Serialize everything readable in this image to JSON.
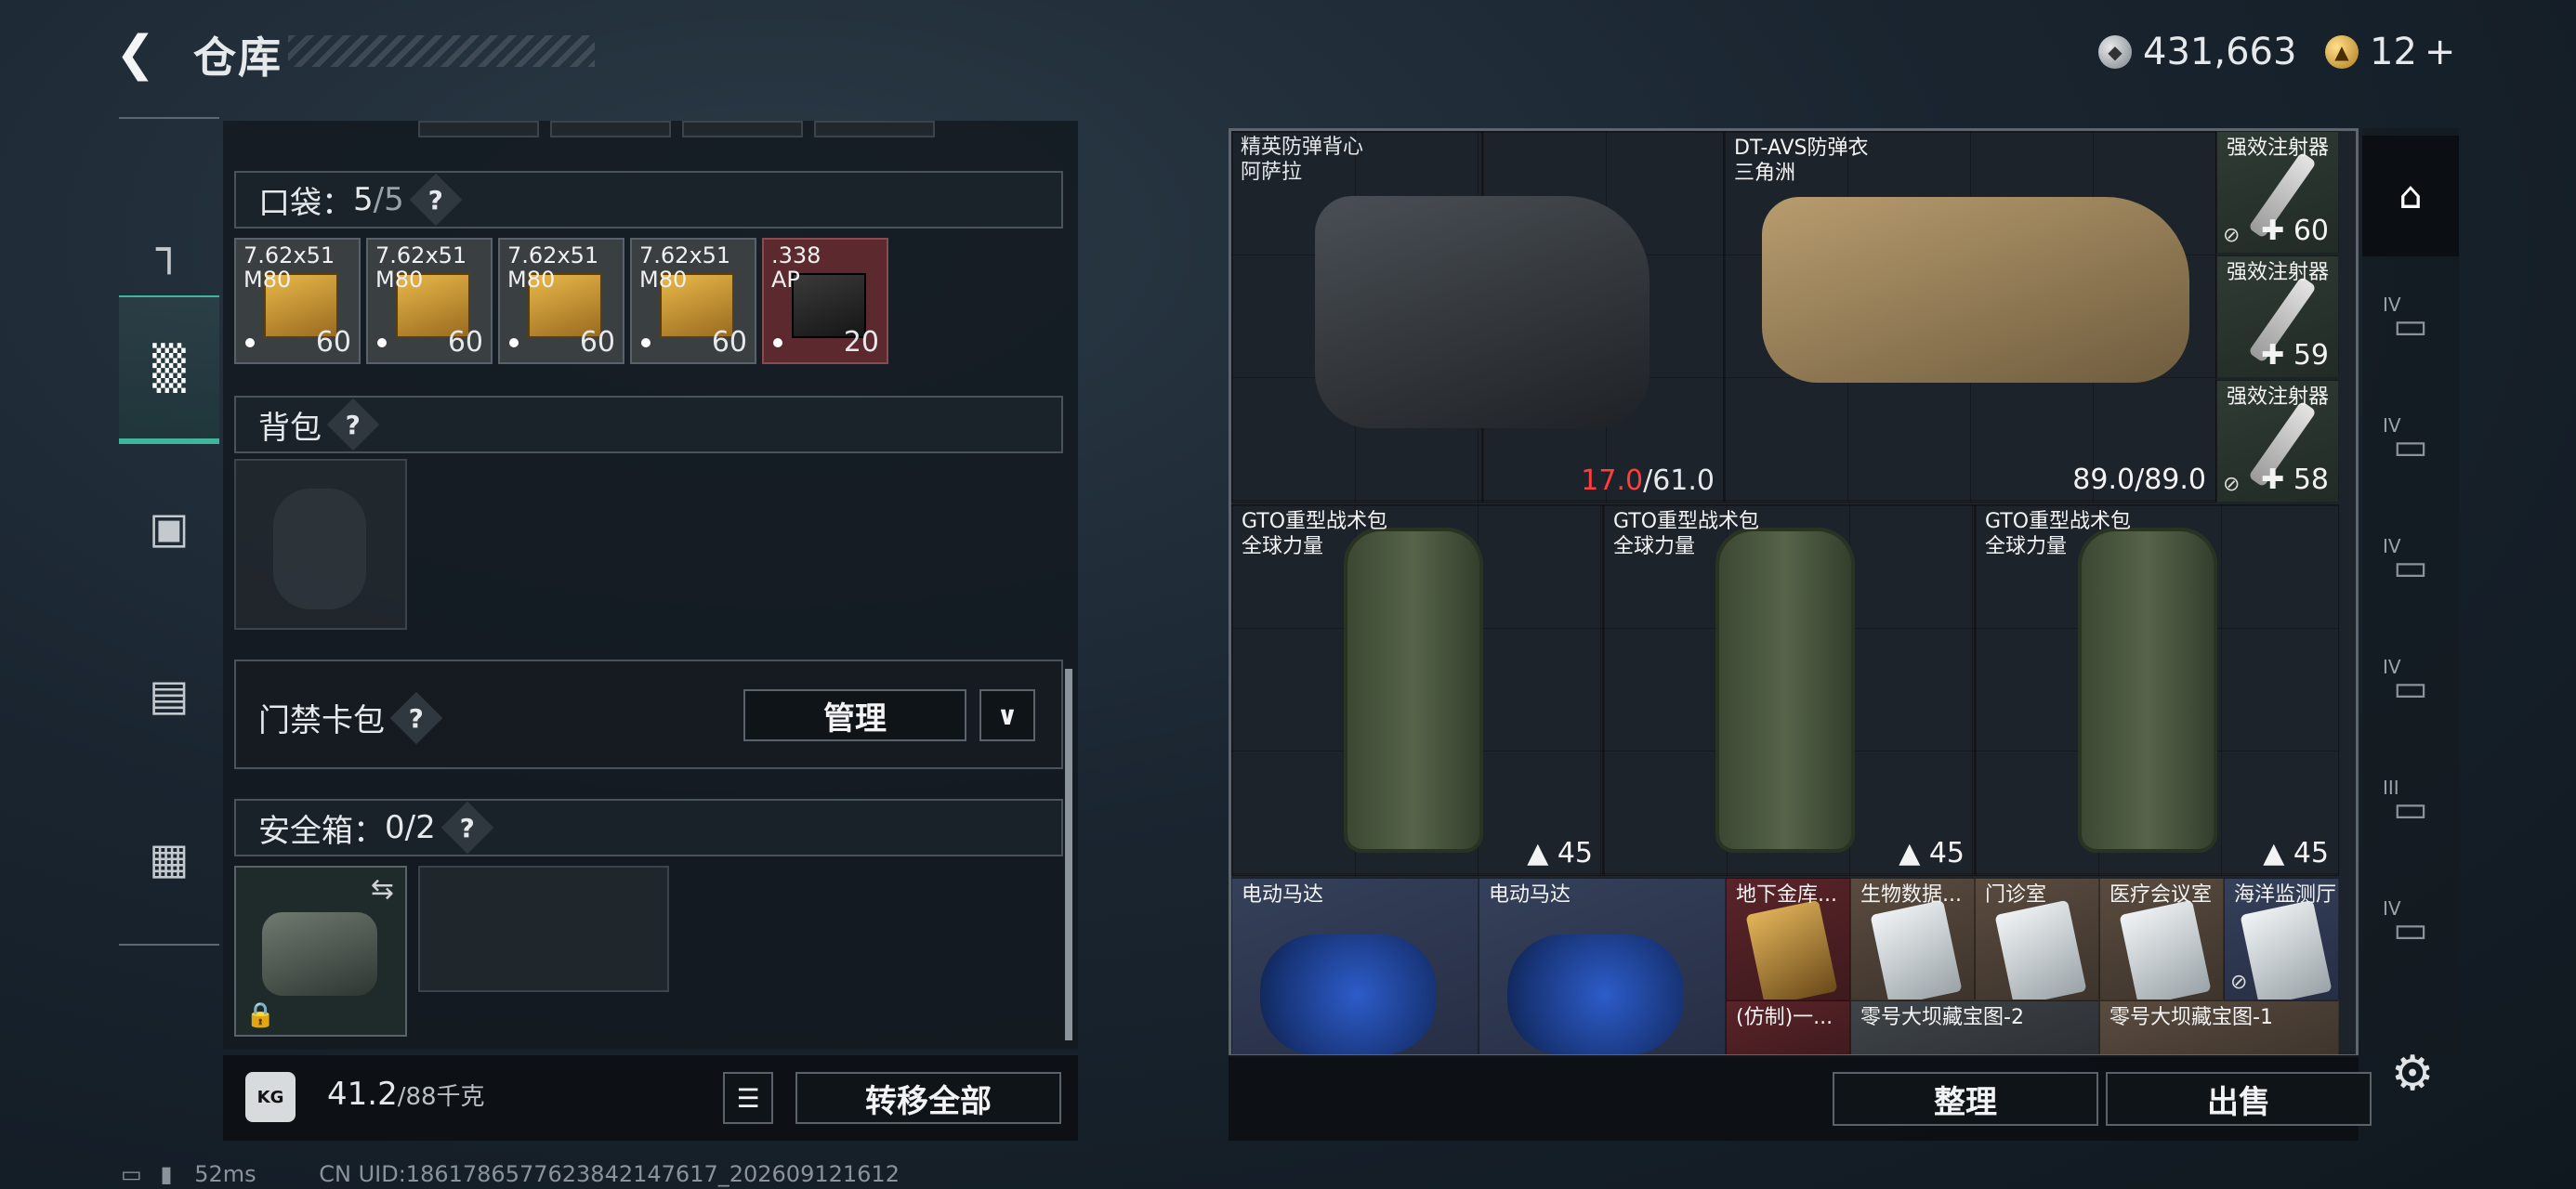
{
  "header": {
    "title": "仓库",
    "currency_silver": "431,663",
    "currency_gold": "12",
    "add_symbol": "+"
  },
  "sidenav": {
    "items": [
      {
        "name": "weapons",
        "icon": "pistol-icon"
      },
      {
        "name": "gear",
        "icon": "vest-icon"
      },
      {
        "name": "backpack",
        "icon": "backpack-icon"
      },
      {
        "name": "container",
        "icon": "case-icon"
      },
      {
        "name": "tools",
        "icon": "toolbox-icon"
      }
    ]
  },
  "pockets": {
    "label": "口袋：",
    "count": "5",
    "capacity": "/5",
    "help": "?",
    "items": [
      {
        "line1": "7.62x51",
        "line2": "M80",
        "count": "60",
        "style": "gray"
      },
      {
        "line1": "7.62x51",
        "line2": "M80",
        "count": "60",
        "style": "gray"
      },
      {
        "line1": "7.62x51",
        "line2": "M80",
        "count": "60",
        "style": "gray"
      },
      {
        "line1": "7.62x51",
        "line2": "M80",
        "count": "60",
        "style": "gray"
      },
      {
        "line1": ".338",
        "line2": "AP",
        "count": "20",
        "style": "red"
      }
    ]
  },
  "backpack": {
    "label": "背包",
    "help": "?"
  },
  "keycard": {
    "label": "门禁卡包",
    "help": "?",
    "manage": "管理",
    "expand": "∨"
  },
  "safebox": {
    "label": "安全箱：",
    "count": "0/2",
    "help": "?"
  },
  "weight": {
    "current": "41.2",
    "max": "/88千克",
    "kg_icon": "KG"
  },
  "actions": {
    "list_icon": "☰",
    "transfer_all": "转移全部"
  },
  "stash": {
    "items": [
      {
        "name1": "精英防弹背心",
        "name2": "阿萨拉",
        "durability_current": "17.0",
        "durability_max": "/61.0"
      },
      {
        "name1": "DT-AVS防弹衣",
        "name2": "三角洲",
        "durability": "89.0/89.0"
      },
      {
        "name1": "强效注射器",
        "value": "60"
      },
      {
        "name1": "强效注射器",
        "value": "59"
      },
      {
        "name1": "强效注射器",
        "value": "58"
      },
      {
        "name1": "GTO重型战术包",
        "name2": "全球力量",
        "value": "45"
      },
      {
        "name1": "GTO重型战术包",
        "name2": "全球力量",
        "value": "45"
      },
      {
        "name1": "GTO重型战术包",
        "name2": "全球力量",
        "value": "45"
      },
      {
        "name1": "电动马达"
      },
      {
        "name1": "电动马达"
      },
      {
        "name1": "地下金库...",
        "sub": "(仿制)一..."
      },
      {
        "name1": "生物数据...",
        "sub": "零号大坝藏宝图-2"
      },
      {
        "name1": "门诊室"
      },
      {
        "name1": "医疗会议室",
        "sub": "零号大坝藏宝图-1"
      },
      {
        "name1": "海洋监测厅"
      }
    ],
    "sort_label": "整理",
    "sell_label": "出售"
  },
  "right_tabs": [
    {
      "icon": "home-stash-icon",
      "level": ""
    },
    {
      "icon": "folder-icon",
      "level": "IV"
    },
    {
      "icon": "folder-icon",
      "level": "IV"
    },
    {
      "icon": "gun-folder-icon",
      "level": "IV"
    },
    {
      "icon": "gun-folder-icon",
      "level": "IV"
    },
    {
      "icon": "folder-icon",
      "level": "III"
    },
    {
      "icon": "add-folder-icon",
      "level": "IV"
    }
  ],
  "status": {
    "ping": "52ms",
    "uid": "CN UID:1861786577623842147617_202609121612"
  },
  "colors": {
    "accent": "#3fb59c",
    "warning": "#ff3d3d"
  }
}
